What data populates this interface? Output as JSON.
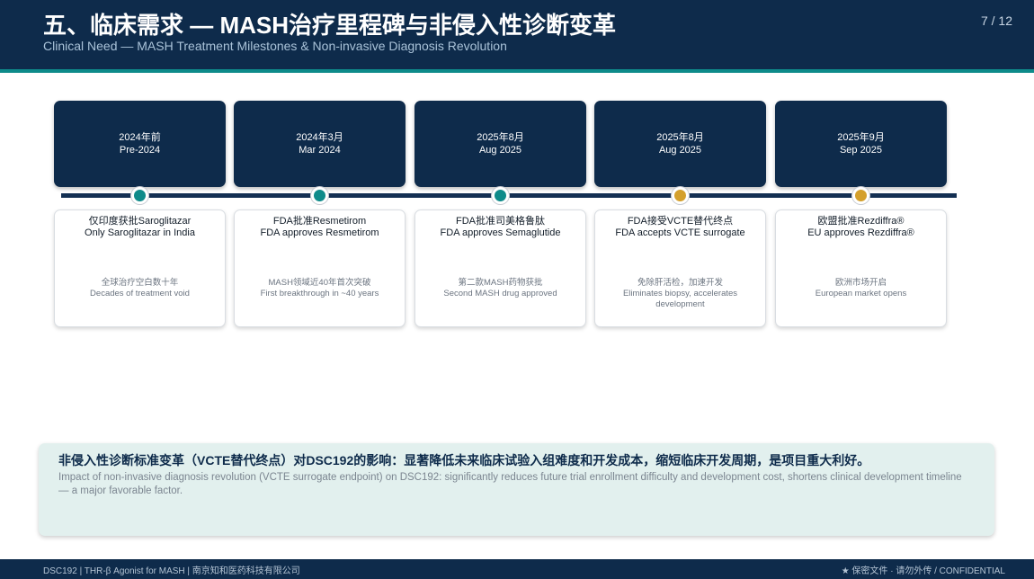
{
  "header": {
    "title": "五、临床需求 — MASH治疗里程碑与非侵入性诊断变革",
    "subtitle": "Clinical Need — MASH Treatment Milestones & Non-invasive Diagnosis Revolution",
    "page": "7 / 12"
  },
  "colors": {
    "navy": "#0e2b4b",
    "teal": "#0e8b8a",
    "gold": "#d4a02c",
    "impact_bg": "#e2f0ee"
  },
  "milestones": [
    {
      "date_zh": "2024年前",
      "date_en": "Pre-2024",
      "title_zh": "仅印度获批Saroglitazar",
      "title_en": "Only Saroglitazar in India",
      "desc_zh": "全球治疗空白数十年",
      "desc_en": "Decades of treatment void",
      "marker": "teal"
    },
    {
      "date_zh": "2024年3月",
      "date_en": "Mar 2024",
      "title_zh": "FDA批准Resmetirom",
      "title_en": "FDA approves Resmetirom",
      "desc_zh": "MASH领域近40年首次突破",
      "desc_en": "First breakthrough in ~40 years",
      "marker": "teal"
    },
    {
      "date_zh": "2025年8月",
      "date_en": "Aug 2025",
      "title_zh": "FDA批准司美格鲁肽",
      "title_en": "FDA approves Semaglutide",
      "desc_zh": "第二款MASH药物获批",
      "desc_en": "Second MASH drug approved",
      "marker": "teal"
    },
    {
      "date_zh": "2025年8月",
      "date_en": "Aug 2025",
      "title_zh": "FDA接受VCTE替代终点",
      "title_en": "FDA accepts VCTE surrogate",
      "desc_zh": "免除肝活检，加速开发",
      "desc_en": "Eliminates biopsy, accelerates development",
      "marker": "gold"
    },
    {
      "date_zh": "2025年9月",
      "date_en": "Sep 2025",
      "title_zh": "欧盟批准Rezdiffra®",
      "title_en": "EU approves Rezdiffra®",
      "desc_zh": "欧洲市场开启",
      "desc_en": "European market opens",
      "marker": "gold"
    }
  ],
  "impact": {
    "zh": "非侵入性诊断标准变革（VCTE替代终点）对DSC192的影响：显著降低未来临床试验入组难度和开发成本，缩短临床开发周期，是项目重大利好。",
    "en": "Impact of non-invasive diagnosis revolution (VCTE surrogate endpoint) on DSC192: significantly reduces future trial enrollment difficulty and development cost, shortens clinical development timeline — a major favorable factor."
  },
  "footer": {
    "left": "DSC192 | THR-β Agonist for MASH | 南京知和医药科技有限公司",
    "right": "★ 保密文件 · 请勿外传 / CONFIDENTIAL"
  }
}
